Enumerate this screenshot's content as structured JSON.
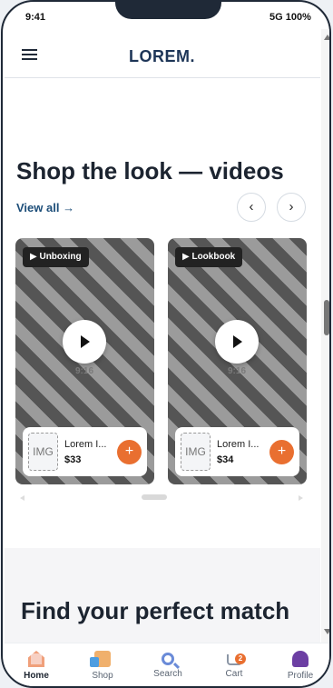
{
  "status": {
    "time": "9:41",
    "network": "5G",
    "battery": "100%"
  },
  "header": {
    "brand": "LOREM."
  },
  "section": {
    "title": "Shop the look — videos",
    "view_all": "View all →",
    "prev": "‹",
    "next": "›"
  },
  "videos": [
    {
      "tag": "▶ Unboxing",
      "ratio": "9:16",
      "product_name": "Lorem I...",
      "price": "$33",
      "add": "+"
    },
    {
      "tag": "▶ Lookbook",
      "ratio": "9:16",
      "product_name": "Lorem I...",
      "price": "$34",
      "add": "+"
    }
  ],
  "band": {
    "title": "Find your perfect match"
  },
  "tabs": [
    {
      "label": "Home",
      "icon": "home-icon"
    },
    {
      "label": "Shop",
      "icon": "shopping-bag-icon"
    },
    {
      "label": "Search",
      "icon": "search-icon"
    },
    {
      "label": "Cart",
      "icon": "cart-icon",
      "badge": "2"
    },
    {
      "label": "Profile",
      "icon": "profile-icon"
    }
  ],
  "colors": {
    "brand": "#1d3557",
    "accent": "#e96f30",
    "link": "#1d4e79"
  }
}
